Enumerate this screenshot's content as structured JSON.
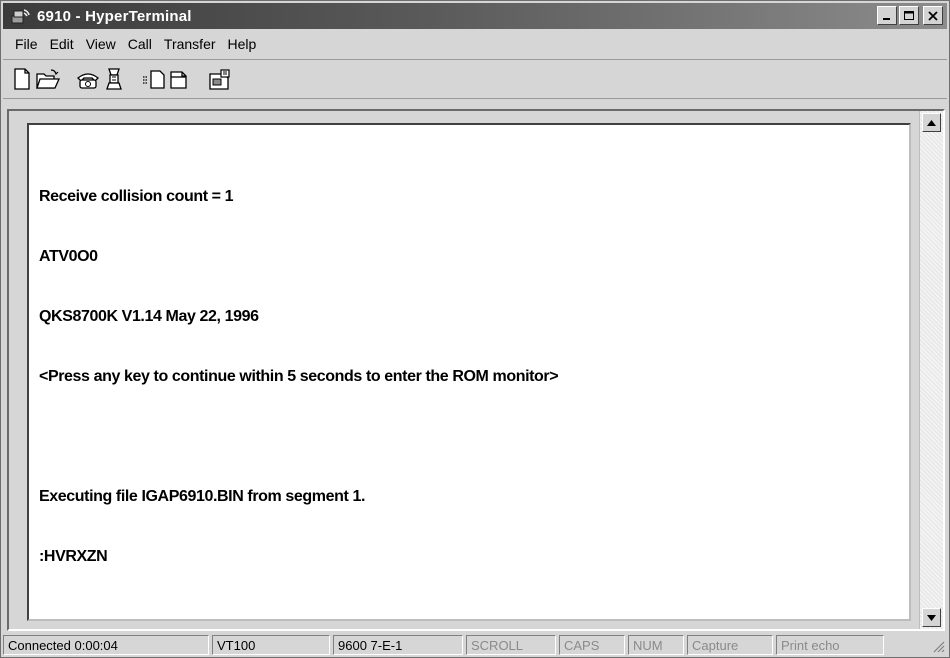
{
  "window": {
    "title": "6910 - HyperTerminal",
    "controls": {
      "minimize": "_",
      "maximize": "□",
      "close": "✕"
    }
  },
  "menu": {
    "items": [
      "File",
      "Edit",
      "View",
      "Call",
      "Transfer",
      "Help"
    ]
  },
  "toolbar": {
    "buttons": [
      "new-icon",
      "open-icon",
      "connect-icon",
      "disconnect-icon",
      "send-icon",
      "receive-icon",
      "properties-icon"
    ]
  },
  "terminal": {
    "lines": [
      "Receive collision count = 1",
      "ATV0O0",
      "QKS8700K V1.14 May 22, 1996",
      "<Press any key to continue within 5 seconds to enter the ROM monitor>",
      "",
      "Executing file IGAP6910.BIN from segment 1.",
      ":HVRXZN"
    ]
  },
  "status": {
    "connected": "Connected 0:00:04",
    "emulation": "VT100",
    "settings": "9600 7-E-1",
    "scroll": "SCROLL",
    "caps": "CAPS",
    "num": "NUM",
    "capture": "Capture",
    "print_echo": "Print echo"
  }
}
